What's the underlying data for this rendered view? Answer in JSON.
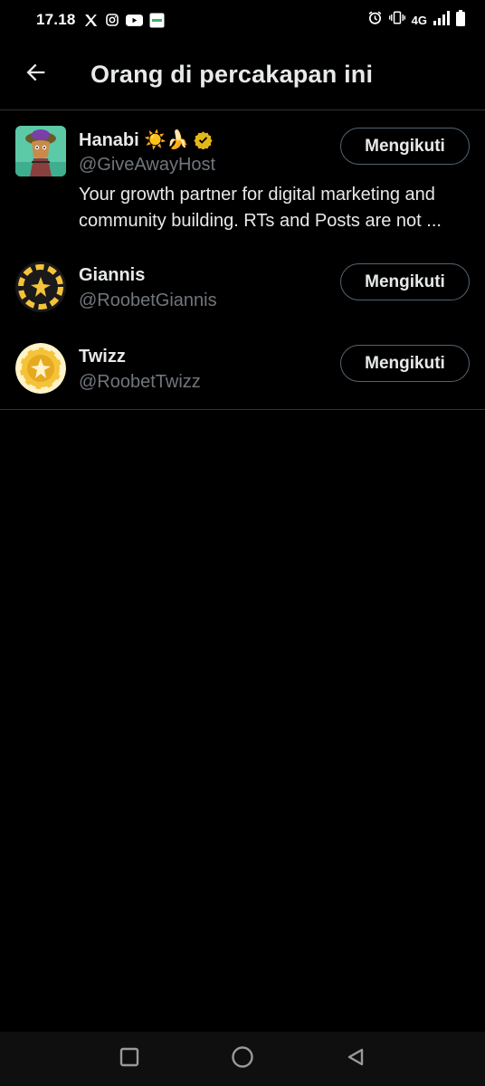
{
  "status_bar": {
    "time": "17.18",
    "network": "4G",
    "icons": [
      "x-logo-icon",
      "instagram-icon",
      "youtube-icon",
      "app-notification-icon",
      "alarm-icon",
      "vibrate-icon",
      "signal-icon",
      "battery-icon"
    ]
  },
  "header": {
    "title": "Orang di percakapan ini",
    "back_icon": "arrow-left-icon"
  },
  "people": [
    {
      "name": "Hanabi ☀️🍌",
      "handle": "@GiveAwayHost",
      "verified": true,
      "bio": "Your growth partner for digital marketing and community building. RTs and Posts are not ...",
      "follow_label": "Mengikuti"
    },
    {
      "name": "Giannis",
      "handle": "@RoobetGiannis",
      "verified": false,
      "follow_label": "Mengikuti"
    },
    {
      "name": "Twizz",
      "handle": "@RoobetTwizz",
      "verified": false,
      "follow_label": "Mengikuti"
    }
  ],
  "nav_bar": {
    "buttons": [
      "recents-square-icon",
      "home-circle-icon",
      "back-triangle-icon"
    ]
  },
  "colors": {
    "background": "#000000",
    "text_primary": "#e7e9ea",
    "text_secondary": "#71767b",
    "divider": "#2f3336",
    "verified_gold": "#e2b719",
    "roobet_gold": "#f5c33a"
  }
}
